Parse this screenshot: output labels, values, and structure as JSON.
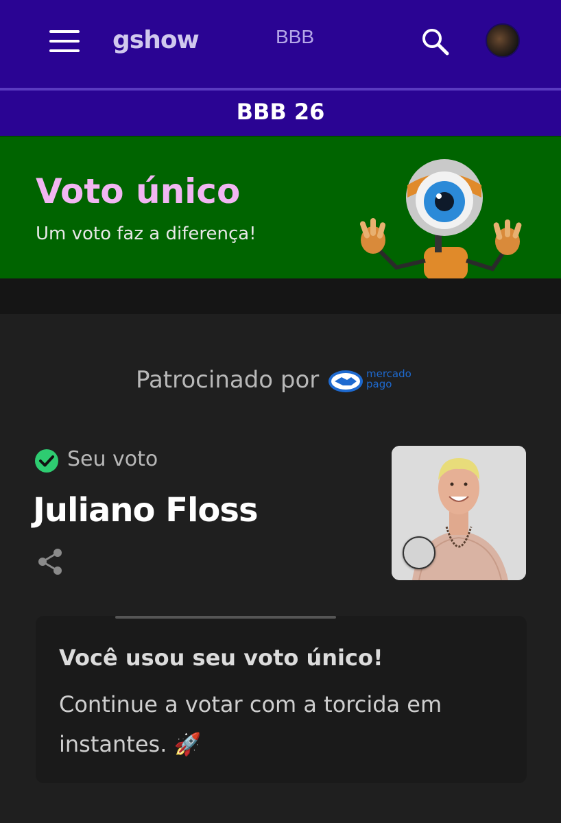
{
  "header": {
    "logo_text": "gshow",
    "nav_title": "BBB"
  },
  "subheader": {
    "title": "BBB 26"
  },
  "banner": {
    "title": "Voto único",
    "subtitle": "Um voto faz a diferença!"
  },
  "sponsor": {
    "label": "Patrocinado por",
    "logo_text": "mercado\npago"
  },
  "vote": {
    "status_label": "Seu voto",
    "candidate_name": "Juliano Floss"
  },
  "card": {
    "title": "Você usou seu voto único!",
    "body": "Continue a votar com a torcida em instantes. 🚀"
  },
  "colors": {
    "header_bg": "#2a0493",
    "banner_bg": "#006400",
    "banner_title": "#f1b6f2",
    "check_green": "#2ecc71",
    "page_bg": "#1f1f1f"
  },
  "icons": [
    "menu-icon",
    "search-icon",
    "check-circle-icon",
    "share-icon",
    "mercado-pago-handshake-icon",
    "big-brother-eye-icon"
  ]
}
